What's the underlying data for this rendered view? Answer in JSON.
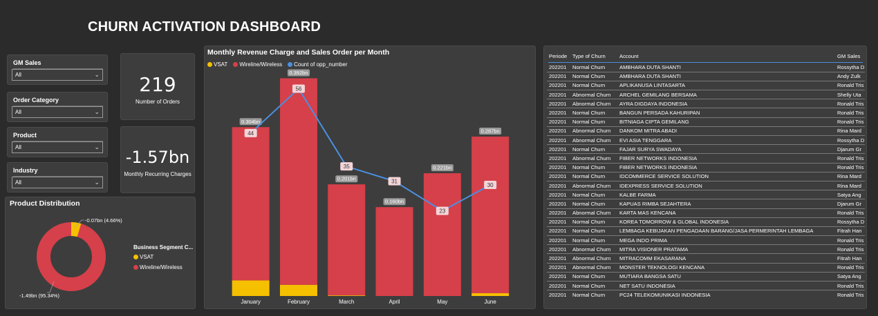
{
  "header": {
    "title": "CHURN ACTIVATION DASHBOARD"
  },
  "slicers": [
    {
      "label": "GM Sales",
      "value": "All"
    },
    {
      "label": "Order Category",
      "value": "All"
    },
    {
      "label": "Product",
      "value": "All"
    },
    {
      "label": "Industry",
      "value": "All"
    }
  ],
  "cards": {
    "orders": {
      "value": "219",
      "label": "Number of Orders"
    },
    "mrc": {
      "value": "-1.57bn",
      "label": "Monthly Recurring Charges"
    }
  },
  "product_distribution": {
    "title": "Product Distribution",
    "legend_title": "Business Segment C...",
    "legend": [
      {
        "name": "VSAT",
        "color": "#f5c000"
      },
      {
        "name": "Wireline/Wireless",
        "color": "#d6404a"
      }
    ],
    "labels": {
      "vsat": "-0.07bn (4.66%)",
      "wireline": "-1.49bn (95.34%)"
    }
  },
  "chart_data": [
    {
      "type": "pie",
      "title": "Product Distribution",
      "categories": [
        "VSAT",
        "Wireline/Wireless"
      ],
      "values": [
        -0.07,
        -1.49
      ],
      "percentages": [
        4.66,
        95.34
      ],
      "colors": [
        "#f5c000",
        "#d6404a"
      ]
    },
    {
      "type": "bar",
      "title": "Monthly Revenue Charge and Sales Order per Month",
      "categories": [
        "January",
        "February",
        "March",
        "April",
        "May",
        "June"
      ],
      "series": [
        {
          "name": "VSAT",
          "values": [
            0.028,
            0.02,
            0.001,
            0.0,
            0.0,
            0.005
          ],
          "color": "#f5c000"
        },
        {
          "name": "Wireline/Wireless",
          "values": [
            0.276,
            0.372,
            0.2,
            0.16,
            0.221,
            0.282
          ],
          "color": "#d6404a"
        },
        {
          "name": "Count of opp_number",
          "type": "line",
          "values": [
            44,
            56,
            35,
            31,
            23,
            30
          ],
          "color": "#4a90e2"
        }
      ],
      "total_labels": [
        "0.304bn",
        "0.392bn",
        "0.201bn",
        "0.160bn",
        "0.221bn",
        "0.287bn"
      ],
      "ylim": [
        0,
        0.4
      ],
      "y2lim": [
        0,
        60
      ]
    }
  ],
  "revenue_chart": {
    "title": "Monthly Revenue Charge and Sales Order per Month",
    "legend": [
      {
        "name": "VSAT",
        "color": "#f5c000"
      },
      {
        "name": "Wireline/Wireless",
        "color": "#d6404a"
      },
      {
        "name": "Count of opp_number",
        "color": "#4a90e2"
      }
    ]
  },
  "table": {
    "columns": [
      "Periode",
      "Type of Churn",
      "Account",
      "GM Sales"
    ],
    "rows": [
      [
        "202201",
        "Normal Churn",
        "AMBHARA DUTA SHANTI",
        "Rossytha D"
      ],
      [
        "202201",
        "Normal Churn",
        "AMBHARA DUTA SHANTI",
        "Andy Zulk"
      ],
      [
        "202201",
        "Normal Churn",
        "APLIKANUSA LINTASARTA",
        "Ronald Tris"
      ],
      [
        "202201",
        "Abnormal Churn",
        "ARCHEL GEMILANG BERSAMA",
        "Shelly Uta"
      ],
      [
        "202201",
        "Abnormal Churn",
        "AYRA DIGDAYA INDONESIA",
        "Ronald Tris"
      ],
      [
        "202201",
        "Normal Churn",
        "BANGUN PERSADA KAHURIPAN",
        "Ronald Tris"
      ],
      [
        "202201",
        "Normal Churn",
        "BITNIAGA CIPTA GEMILANG",
        "Ronald Tris"
      ],
      [
        "202201",
        "Abnormal Churn",
        "DANKOM MITRA ABADI",
        "Rina Mard"
      ],
      [
        "202201",
        "Abnormal Churn",
        "EVI ASIA TENGGARA",
        "Rossytha D"
      ],
      [
        "202201",
        "Normal Churn",
        "FAJAR SURYA SWADAYA",
        "Djarum Gr"
      ],
      [
        "202201",
        "Abnormal Churn",
        "FIBER NETWORKS INDONESIA",
        "Ronald Tris"
      ],
      [
        "202201",
        "Normal Churn",
        "FIBER NETWORKS INDONESIA",
        "Ronald Tris"
      ],
      [
        "202201",
        "Normal Churn",
        "IDCOMMERCE SERVICE SOLUTION",
        "Rina Mard"
      ],
      [
        "202201",
        "Abnormal Churn",
        "IDEXPRESS SERVICE SOLUTION",
        "Rina Mard"
      ],
      [
        "202201",
        "Normal Churn",
        "KALBE FARMA",
        "Satya Ang"
      ],
      [
        "202201",
        "Normal Churn",
        "KAPUAS RIMBA SEJAHTERA",
        "Djarum Gr"
      ],
      [
        "202201",
        "Abnormal Churn",
        "KARTA MAS KENCANA",
        "Ronald Tris"
      ],
      [
        "202201",
        "Normal Churn",
        "KOREA TOMORROW & GLOBAL INDONESIA",
        "Rossytha D"
      ],
      [
        "202201",
        "Normal Churn",
        "LEMBAGA KEBIJAKAN PENGADAAN BARANG/JASA PERMERINTAH LEMBAGA",
        "Fitrah Han"
      ],
      [
        "202201",
        "Normal Churn",
        "MEGA INDO PRIMA",
        "Ronald Tris"
      ],
      [
        "202201",
        "Abnormal Churn",
        "MITRA VISIONER PRATAMA",
        "Ronald Tris"
      ],
      [
        "202201",
        "Abnormal Churn",
        "MITRACOMM EKASARANA",
        "Fitrah Han"
      ],
      [
        "202201",
        "Abnormal Churn",
        "MONSTER TEKNOLOGI KENCANA",
        "Ronald Tris"
      ],
      [
        "202201",
        "Normal Churn",
        "MUTIARA BANGSA SATU",
        "Satya Ang"
      ],
      [
        "202201",
        "Normal Churn",
        "NET SATU INDONESIA",
        "Ronald Tris"
      ],
      [
        "202201",
        "Normal Churn",
        "PC24 TELEKOMUNIKASI INDONESIA",
        "Ronald Tris"
      ]
    ]
  }
}
